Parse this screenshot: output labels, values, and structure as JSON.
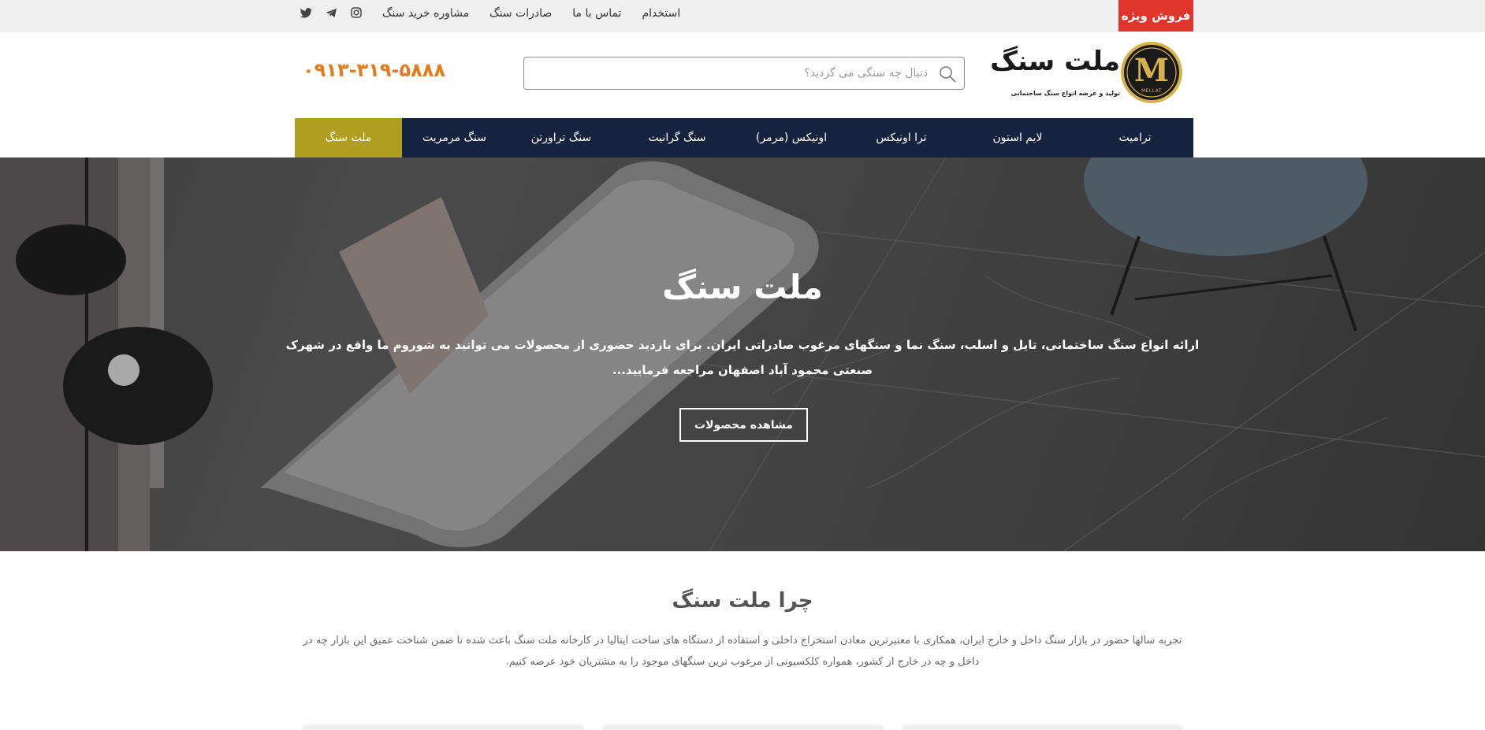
{
  "topbar": {
    "sale_label": "فروش ویژه",
    "links": [
      "مشاوره خرید سنگ",
      "صادرات سنگ",
      "تماس با ما",
      "استخدام"
    ],
    "social_icons": [
      "twitter-icon",
      "telegram-icon",
      "instagram-icon"
    ]
  },
  "header": {
    "logo_title": "ملت سنگ",
    "logo_subtitle": "تولید و عرضه انواع سنگ ساختمانی",
    "logo_mark": "M",
    "logo_word": "MELLAT",
    "search_placeholder": "دنبال چه سنگی می گردید؟",
    "search_value": "",
    "phone": "۰۹۱۳-۳۱۹-۵۸۸۸"
  },
  "nav": {
    "items": [
      {
        "label": "ملت سنگ",
        "active": true
      },
      {
        "label": "سنگ مرمریت",
        "active": false
      },
      {
        "label": "سنگ تراورتن",
        "active": false
      },
      {
        "label": "سنگ گرانیت",
        "active": false
      },
      {
        "label": "اونیکس (مرمر)",
        "active": false
      },
      {
        "label": "ترا اونیکس",
        "active": false
      },
      {
        "label": "لایم استون",
        "active": false
      },
      {
        "label": "ترامیت",
        "active": false
      }
    ]
  },
  "hero": {
    "title": "ملت سنگ",
    "text": "ارائه انواع سنگ ساختمانی، تایل و اسلب، سنگ نما و سنگهای مرغوب صادراتی ایران. برای بازدید حضوری از محصولات می توانید به شوروم ما واقع در شهرک صنعتی محمود آباد اصفهان مراجعه فرمایید...",
    "button_label": "مشاهده محصولات"
  },
  "why": {
    "title": "چرا ملت سنگ",
    "text": "تجربه سالها حضور در بازار سنگ داخل و خارج ایران، همکاری با معتبرترین معادن استخراج داخلی و استفاده از دستگاه های ساخت ایتالیا در کارخانه ملت سنگ باعث شده تا ضمن شناخت عمیق این بازار چه در داخل و چه در خارج از کشور، همواره کلکسیونی از مرغوب ترین سنگهای موجود را به مشتریان خود عرضه کنیم."
  },
  "colors": {
    "sale": "#e1352b",
    "nav_bg": "#16233f",
    "nav_active": "#b09e21",
    "phone": "#e27d1e",
    "topbar_bg": "#efefef"
  }
}
